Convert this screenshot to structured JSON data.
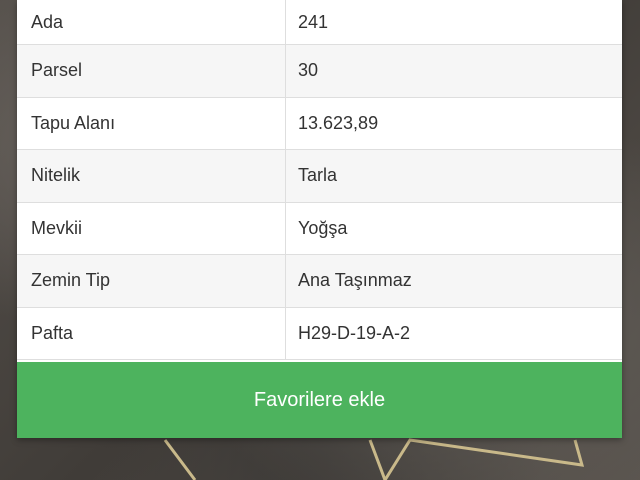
{
  "parcel_info": {
    "rows": [
      {
        "key": "Ada",
        "value": "241"
      },
      {
        "key": "Parsel",
        "value": "30"
      },
      {
        "key": "Tapu Alanı",
        "value": "13.623,89"
      },
      {
        "key": "Nitelik",
        "value": "Tarla"
      },
      {
        "key": "Mevkii",
        "value": "Yoğşa"
      },
      {
        "key": "Zemin Tip",
        "value": "Ana Taşınmaz"
      },
      {
        "key": "Pafta",
        "value": "H29-D-19-A-2"
      }
    ]
  },
  "actions": {
    "add_favorites_label": "Favorilere ekle"
  },
  "colors": {
    "button_green": "#4db35e",
    "parcel_outline": "#c9b98a"
  }
}
